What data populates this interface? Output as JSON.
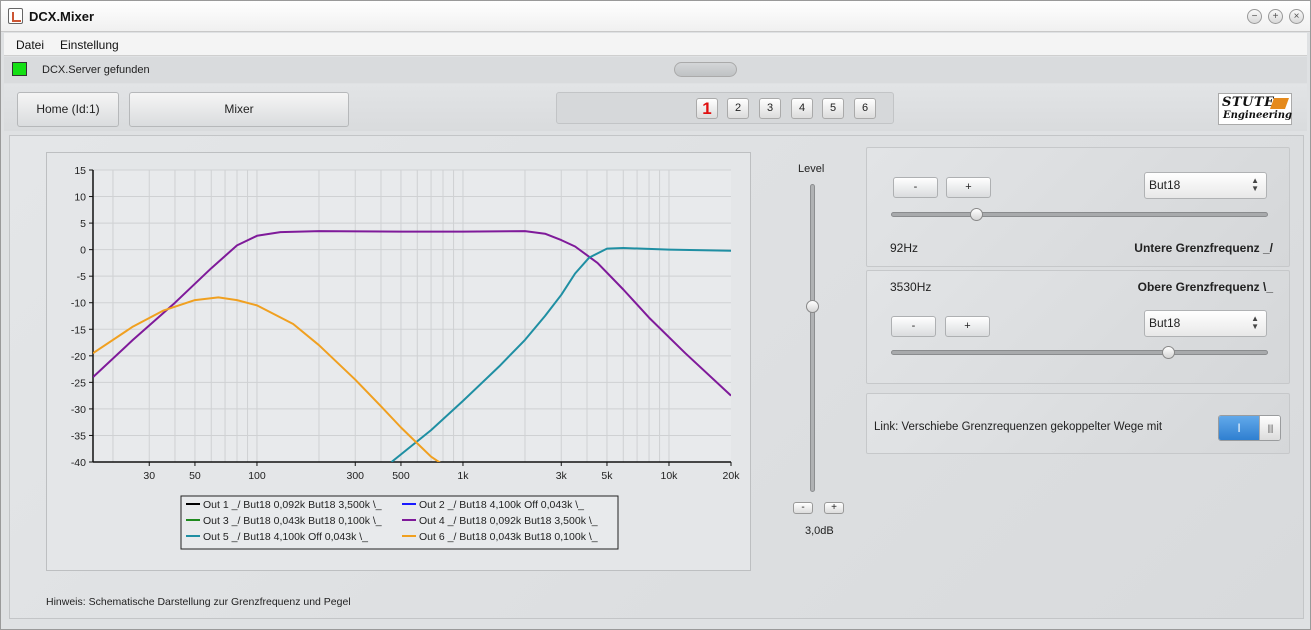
{
  "window": {
    "title": "DCX.Mixer",
    "buttons": [
      "−",
      "+",
      "×"
    ]
  },
  "menu": {
    "items": [
      "Datei",
      "Einstellung"
    ]
  },
  "status": {
    "led_color": "#14e014",
    "text": "DCX.Server gefunden"
  },
  "toolbar": {
    "home_label": "Home (Id:1)",
    "mixer_label": "Mixer",
    "channels": [
      "1",
      "2",
      "3",
      "4",
      "5",
      "6"
    ],
    "active_channel": "1",
    "logo_line1": "STUTE",
    "logo_line2": "Engineering"
  },
  "chart_data": {
    "type": "line",
    "x_scale": "log",
    "xlim": [
      16,
      20000
    ],
    "ylim": [
      -40,
      15
    ],
    "x_ticks": [
      30,
      50,
      100,
      300,
      500,
      1000,
      3000,
      5000,
      10000,
      20000
    ],
    "x_tick_labels": [
      "30",
      "50",
      "100",
      "300",
      "500",
      "1k",
      "3k",
      "5k",
      "10k",
      "20k"
    ],
    "y_ticks": [
      15,
      10,
      5,
      0,
      -5,
      -10,
      -15,
      -20,
      -25,
      -30,
      -35,
      -40
    ],
    "grid": true,
    "legend_position": "bottom-center",
    "series": [
      {
        "name": "Out 1 _/ But18 0,092k But18 3,500k \\_",
        "color": "#000000",
        "x": [],
        "y": []
      },
      {
        "name": "Out 2 _/ But18 4,100k Off 0,043k \\_",
        "color": "#1a1aff",
        "x": [],
        "y": []
      },
      {
        "name": "Out 3 _/ But18 0,043k But18 0,100k \\_",
        "color": "#1e8a1e",
        "x": [],
        "y": []
      },
      {
        "name": "Out 4 _/ But18 0,092k But18 3,500k \\_",
        "color": "#7f1a9a",
        "x": [
          16,
          25,
          40,
          60,
          80,
          100,
          130,
          200,
          500,
          1000,
          2000,
          2500,
          3000,
          3500,
          4500,
          6000,
          8000,
          12000,
          20000
        ],
        "y": [
          -24,
          -17,
          -10,
          -3.5,
          0.8,
          2.6,
          3.3,
          3.5,
          3.4,
          3.4,
          3.5,
          3.0,
          1.8,
          0.6,
          -2.5,
          -7.5,
          -12.8,
          -19.5,
          -27.5
        ]
      },
      {
        "name": "Out 5 _/ But18 4,100k Off 0,043k \\_",
        "color": "#1f8fa3",
        "x": [
          450,
          700,
          1000,
          1500,
          2000,
          2500,
          3000,
          3500,
          4100,
          5000,
          6000,
          10000,
          20000
        ],
        "y": [
          -40,
          -34,
          -28.5,
          -22,
          -17,
          -12.5,
          -8.5,
          -4.5,
          -1.5,
          0.2,
          0.3,
          0,
          -0.2
        ]
      },
      {
        "name": "Out 6 _/ But18 0,043k But18 0,100k \\_",
        "color": "#f0a020",
        "x": [
          16,
          25,
          35,
          50,
          65,
          80,
          100,
          150,
          200,
          300,
          400,
          500,
          600,
          700,
          800
        ],
        "y": [
          -19.5,
          -14.5,
          -11.5,
          -9.5,
          -9,
          -9.5,
          -10.5,
          -14,
          -18,
          -24.5,
          -29.5,
          -33.5,
          -36.5,
          -39,
          -40.5
        ]
      }
    ]
  },
  "hint": "Hinweis: Schematische Darstellung zur Grenzfrequenz und Pegel",
  "level": {
    "label": "Level",
    "value": "3,0dB",
    "fraction": 0.4,
    "minus": "-",
    "plus": "+"
  },
  "lower": {
    "minus": "-",
    "plus": "+",
    "filter": "But18",
    "freq": "92Hz",
    "title": "Untere Grenzfrequenz _/",
    "slider": 0.23
  },
  "upper": {
    "minus": "-",
    "plus": "+",
    "filter": "But18",
    "freq": "3530Hz",
    "title": "Obere Grenzfrequenz \\_",
    "slider": 0.74
  },
  "link": {
    "text": "Link: Verschiebe Grenzrequenzen gekoppelter Wege mit",
    "state": "I",
    "knob": "||||"
  }
}
